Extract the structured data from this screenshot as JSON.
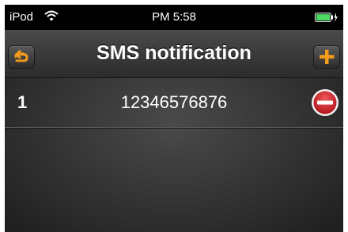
{
  "status_bar": {
    "carrier": "iPod",
    "time": "PM 5:58",
    "wifi_icon": "wifi-icon",
    "battery_icon": "battery-charging-icon"
  },
  "nav": {
    "title": "SMS notification",
    "back_icon": "back-arrow-icon",
    "add_icon": "plus-icon"
  },
  "list": {
    "rows": [
      {
        "index": "1",
        "number": "12346576876",
        "delete_icon": "minus-circle-icon"
      }
    ]
  },
  "colors": {
    "accent": "#f39a1c",
    "delete": "#d8282f"
  }
}
